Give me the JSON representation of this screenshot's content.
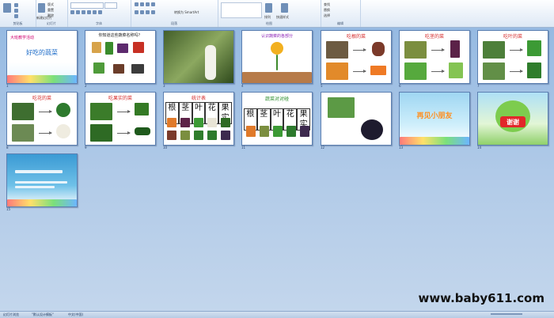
{
  "ribbon": {
    "groups": [
      "剪贴板",
      "幻灯片",
      "字体",
      "段落",
      "绘图",
      "编辑"
    ],
    "items": {
      "layout": "版式",
      "reset": "重置",
      "delete": "删除",
      "new_slide": "新建幻灯片",
      "font_size_value": "",
      "smartart": "转换为 SmartArt",
      "arrange": "排列",
      "quick_styles": "快速样式",
      "find": "查找",
      "replace": "替换",
      "select": "选择"
    }
  },
  "slides": [
    {
      "num": "1",
      "title": "好吃的蔬菜",
      "subtitle": "大班教学活动"
    },
    {
      "num": "2",
      "title": "你知道这些蔬菜名称吗？"
    },
    {
      "num": "3",
      "title": ""
    },
    {
      "num": "4",
      "title": "认识蔬菜的各部分"
    },
    {
      "num": "5",
      "title": "吃根的菜"
    },
    {
      "num": "6",
      "title": "吃茎的菜"
    },
    {
      "num": "7",
      "title": "吃叶的菜"
    },
    {
      "num": "8",
      "title": "吃花的菜"
    },
    {
      "num": "9",
      "title": "吃果实的菜"
    },
    {
      "num": "10",
      "title": "统计表",
      "cells": [
        "根",
        "茎",
        "叶",
        "花",
        "果实"
      ]
    },
    {
      "num": "11",
      "title": "蔬菜对对碰",
      "cells": [
        "根",
        "茎",
        "叶",
        "花",
        "果实"
      ]
    },
    {
      "num": "12",
      "title": ""
    },
    {
      "num": "13",
      "title": "再见小朋友"
    },
    {
      "num": "14",
      "title": "谢谢"
    },
    {
      "num": "15",
      "title": ""
    }
  ],
  "status": {
    "slide_info": "幻灯片浏览",
    "theme": "\"默认设计模板\"",
    "language": "中文(中国)"
  },
  "watermark": "www.baby611.com",
  "colors": {
    "accent": "#2b579a",
    "workspace": "#a9c5e6",
    "title_red": "#d52a2a"
  }
}
